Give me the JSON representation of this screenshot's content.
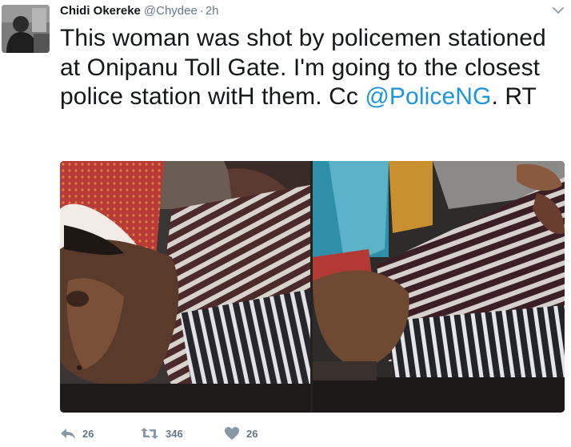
{
  "tweet": {
    "author": {
      "display_name": "Chidi Okereke",
      "handle": "@Chydee",
      "avatar_icon": "profile-photo"
    },
    "separator": "·",
    "timestamp": "2h",
    "text": {
      "part1": "This woman was shot by policemen stationed at Onipanu Toll Gate. I'm going to the closest police station witH them. Cc ",
      "mention": "@PoliceNG",
      "part2": ". RT"
    },
    "media": {
      "photos": [
        {
          "icon": "photo-thumbnail-1"
        },
        {
          "icon": "photo-thumbnail-2"
        }
      ]
    },
    "actions": {
      "reply": {
        "icon": "reply-icon",
        "count": "26"
      },
      "retweet": {
        "icon": "retweet-icon",
        "count": "346"
      },
      "like": {
        "icon": "heart-icon",
        "count": "26"
      }
    },
    "menu_icon": "chevron-down-icon"
  },
  "colors": {
    "text": "#14171a",
    "secondary": "#657786",
    "link": "#1b95e0",
    "background": "#ffffff"
  }
}
